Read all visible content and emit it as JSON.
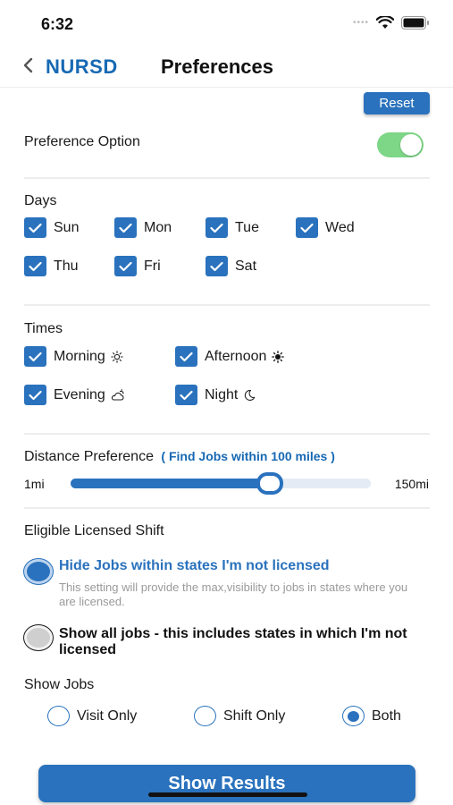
{
  "status_bar": {
    "time": "6:32",
    "dots": "••••"
  },
  "nav": {
    "brand": "NURSD",
    "title": "Preferences"
  },
  "reset_label": "Reset",
  "preference_option": {
    "label": "Preference Option",
    "enabled": true,
    "toggle_color": "#7ed687"
  },
  "days": {
    "label": "Days",
    "items": [
      {
        "label": "Sun",
        "checked": true
      },
      {
        "label": "Mon",
        "checked": true
      },
      {
        "label": "Tue",
        "checked": true
      },
      {
        "label": "Wed",
        "checked": true
      },
      {
        "label": "Thu",
        "checked": true
      },
      {
        "label": "Fri",
        "checked": true
      },
      {
        "label": "Sat",
        "checked": true
      }
    ]
  },
  "times": {
    "label": "Times",
    "items": [
      {
        "label": "Morning",
        "icon": "sun-outline-icon",
        "checked": true
      },
      {
        "label": "Afternoon",
        "icon": "sun-filled-icon",
        "checked": true
      },
      {
        "label": "Evening",
        "icon": "cloud-sun-icon",
        "checked": true
      },
      {
        "label": "Night",
        "icon": "moon-icon",
        "checked": true
      }
    ]
  },
  "distance": {
    "label": "Distance Preference",
    "hint": "( Find Jobs within 100 miles )",
    "min_label": "1mi",
    "max_label": "150mi",
    "min": 1,
    "max": 150,
    "value": 100
  },
  "licensed_shift": {
    "label": "Eligible Licensed Shift",
    "options": [
      {
        "title": "Hide Jobs within states I'm not licensed",
        "description": "This setting will provide the max,visibility to jobs in states where you are licensed.",
        "selected": true
      },
      {
        "title": "Show all jobs - this includes states in which I'm not licensed",
        "selected": false
      }
    ]
  },
  "show_jobs": {
    "label": "Show Jobs",
    "options": [
      {
        "label": "Visit Only",
        "selected": false
      },
      {
        "label": "Shift Only",
        "selected": false
      },
      {
        "label": "Both",
        "selected": true
      }
    ]
  },
  "show_results_label": "Show Results",
  "colors": {
    "primary": "#2a72bd",
    "brand": "#1769b3",
    "toggle_on": "#7ed687",
    "muted_text": "#9a9a9a"
  }
}
